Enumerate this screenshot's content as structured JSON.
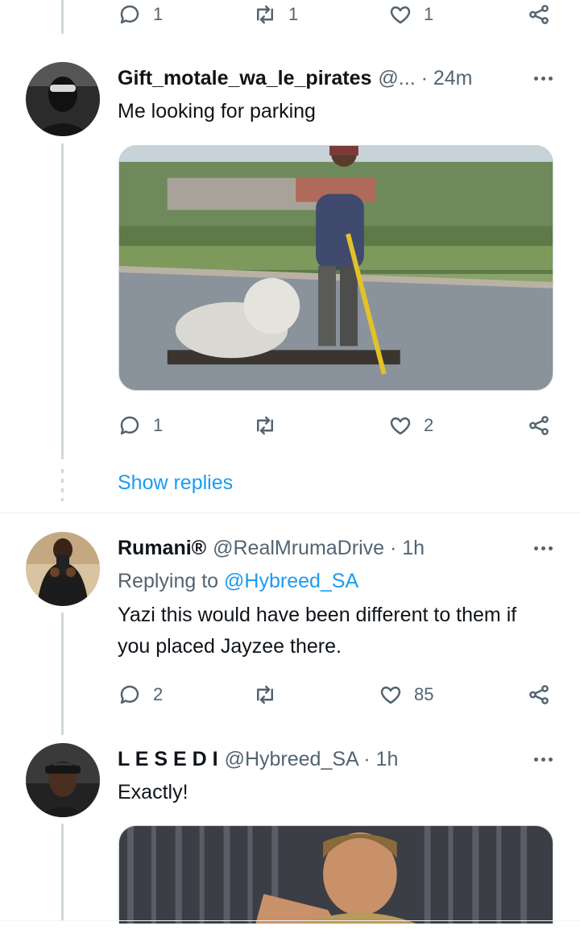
{
  "tweet_top": {
    "reply_count": "1",
    "retweet_count": "1",
    "like_count": "1"
  },
  "tweet1": {
    "author_name": "Gift_motale_wa_le_pirates",
    "handle_time": "@... · 24m",
    "text": "Me looking for parking",
    "media_icon": "photo-man-on-cart",
    "reply_count": "1",
    "retweet_count": "",
    "like_count": "2"
  },
  "show_replies_label": "Show replies",
  "tweet2": {
    "author_name": "Rumani®",
    "handle_time": "@RealMrumaDrive · 1h",
    "replying_prefix": "Replying to",
    "replying_to": "@Hybreed_SA",
    "text": "Yazi this would have been different to them if you placed Jayzee there.",
    "reply_count": "2",
    "retweet_count": "",
    "like_count": "85"
  },
  "tweet3": {
    "author_name": "L E S E D I",
    "handle_time": "@Hybreed_SA · 1h",
    "text": "Exactly!",
    "media_icon": "photo-man-pointing"
  },
  "colors": {
    "text": "#0f1419",
    "secondary": "#536471",
    "link": "#1d9bf0",
    "thread_line": "#cfd9de"
  }
}
